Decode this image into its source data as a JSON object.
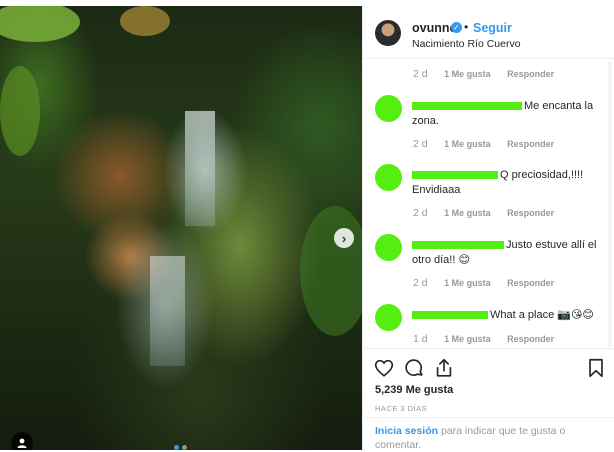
{
  "post": {
    "username": "ovunno",
    "separator": "•",
    "follow_label": "Seguir",
    "location": "Nacimiento Río Cuervo"
  },
  "photo": {
    "next_arrow": "›",
    "carousel_total": 2,
    "carousel_active": 1
  },
  "comments": [
    {
      "time": "2 d",
      "likes": "1 Me gusta",
      "reply": "Responder"
    },
    {
      "text": "Me encanta la zona.",
      "time": "2 d",
      "likes": "1 Me gusta",
      "reply": "Responder"
    },
    {
      "text": "Q preciosidad,!!!! Envidiaaa",
      "time": "2 d",
      "likes": "1 Me gusta",
      "reply": "Responder"
    },
    {
      "text": "Justo estuve allí el otro día!! 😊",
      "time": "2 d",
      "likes": "1 Me gusta",
      "reply": "Responder"
    },
    {
      "text": "What a place 📷😘😊",
      "time": "1 d",
      "likes": "1 Me gusta",
      "reply": "Responder"
    }
  ],
  "actions": {
    "likes_count": "5,239 Me gusta",
    "posted": "HACE 3 DÍAS",
    "login_link": "Inicia sesión",
    "login_rest": " para indicar que te gusta o comentar."
  },
  "icons": [
    "heart-icon",
    "comment-icon",
    "share-icon",
    "bookmark-icon",
    "user-tag-icon",
    "verified-icon",
    "next-arrow-icon"
  ],
  "colors": {
    "accent": "#3897f0",
    "redaction": "#55ee11",
    "muted": "#999999",
    "text": "#262626"
  }
}
